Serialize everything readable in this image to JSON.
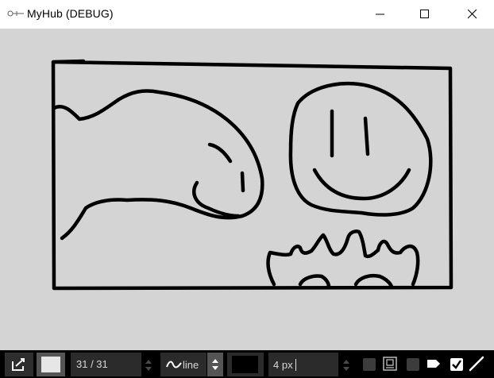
{
  "window": {
    "title": "MyHub (DEBUG)",
    "controls": [
      "minimize",
      "maximize",
      "close"
    ]
  },
  "toolbar": {
    "frame_counter": "31 / 31",
    "brush_mode": "line",
    "stroke_color": "#000000",
    "fill_color": "#e6e6e6",
    "brush_size": "4 px",
    "icons": {
      "edit": "edit-icon",
      "mode": "line-wave-icon",
      "frame_option": "frame-icon",
      "tag_option": "tag-icon",
      "pencil_option": "pencil-icon"
    },
    "options": {
      "frame_checked": false,
      "tag_checked": false,
      "pencil_checked": true
    }
  }
}
